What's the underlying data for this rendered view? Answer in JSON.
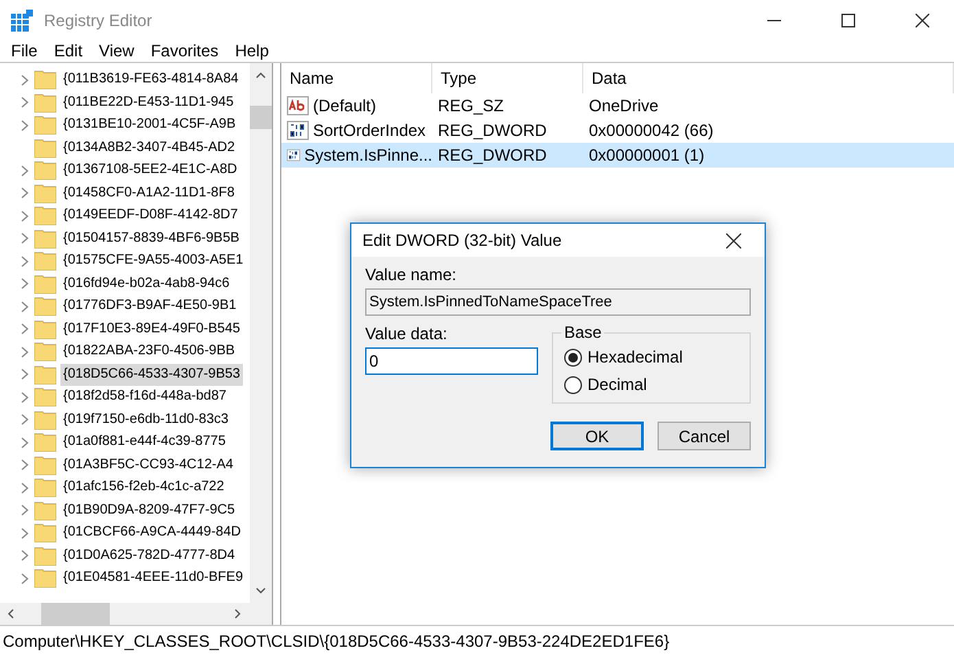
{
  "window": {
    "title": "Registry Editor"
  },
  "menu": [
    "File",
    "Edit",
    "View",
    "Favorites",
    "Help"
  ],
  "tree": [
    {
      "label": "{011B3619-FE63-4814-8A84",
      "expandable": true,
      "selected": false
    },
    {
      "label": "{011BE22D-E453-11D1-945",
      "expandable": true,
      "selected": false
    },
    {
      "label": "{0131BE10-2001-4C5F-A9B",
      "expandable": true,
      "selected": false
    },
    {
      "label": "{0134A8B2-3407-4B45-AD2",
      "expandable": false,
      "selected": false
    },
    {
      "label": "{01367108-5EE2-4E1C-A8D",
      "expandable": true,
      "selected": false
    },
    {
      "label": "{01458CF0-A1A2-11D1-8F8",
      "expandable": true,
      "selected": false
    },
    {
      "label": "{0149EEDF-D08F-4142-8D7",
      "expandable": true,
      "selected": false
    },
    {
      "label": "{01504157-8839-4BF6-9B5B",
      "expandable": true,
      "selected": false
    },
    {
      "label": "{01575CFE-9A55-4003-A5E1",
      "expandable": true,
      "selected": false
    },
    {
      "label": "{016fd94e-b02a-4ab8-94c6",
      "expandable": true,
      "selected": false
    },
    {
      "label": "{01776DF3-B9AF-4E50-9B1",
      "expandable": true,
      "selected": false
    },
    {
      "label": "{017F10E3-89E4-49F0-B545",
      "expandable": true,
      "selected": false
    },
    {
      "label": "{01822ABA-23F0-4506-9BB",
      "expandable": true,
      "selected": false
    },
    {
      "label": "{018D5C66-4533-4307-9B53",
      "expandable": true,
      "selected": true
    },
    {
      "label": "{018f2d58-f16d-448a-bd87",
      "expandable": true,
      "selected": false
    },
    {
      "label": "{019f7150-e6db-11d0-83c3",
      "expandable": true,
      "selected": false
    },
    {
      "label": "{01a0f881-e44f-4c39-8775",
      "expandable": true,
      "selected": false
    },
    {
      "label": "{01A3BF5C-CC93-4C12-A4",
      "expandable": true,
      "selected": false
    },
    {
      "label": "{01afc156-f2eb-4c1c-a722",
      "expandable": true,
      "selected": false
    },
    {
      "label": "{01B90D9A-8209-47F7-9C5",
      "expandable": true,
      "selected": false
    },
    {
      "label": "{01CBCF66-A9CA-4449-84D",
      "expandable": true,
      "selected": false
    },
    {
      "label": "{01D0A625-782D-4777-8D4",
      "expandable": true,
      "selected": false
    },
    {
      "label": "{01E04581-4EEE-11d0-BFE9",
      "expandable": true,
      "selected": false
    }
  ],
  "values": {
    "columns": [
      "Name",
      "Type",
      "Data"
    ],
    "rows": [
      {
        "kind": "string",
        "name": "(Default)",
        "type": "REG_SZ",
        "data": "OneDrive",
        "selected": false
      },
      {
        "kind": "binary",
        "name": "SortOrderIndex",
        "type": "REG_DWORD",
        "data": "0x00000042 (66)",
        "selected": false
      },
      {
        "kind": "binary",
        "name": "System.IsPinne...",
        "type": "REG_DWORD",
        "data": "0x00000001 (1)",
        "selected": true
      }
    ]
  },
  "dialog": {
    "title": "Edit DWORD (32-bit) Value",
    "value_name_label": "Value name:",
    "value_name": "System.IsPinnedToNameSpaceTree",
    "value_data_label": "Value data:",
    "value_data": "0",
    "base_label": "Base",
    "options": [
      {
        "label": "Hexadecimal",
        "selected": true
      },
      {
        "label": "Decimal",
        "selected": false
      }
    ],
    "buttons": [
      {
        "label": "OK",
        "default": true
      },
      {
        "label": "Cancel",
        "default": false
      }
    ]
  },
  "status_bar": "Computer\\HKEY_CLASSES_ROOT\\CLSID\\{018D5C66-4533-4307-9B53-224DE2ED1FE6}"
}
